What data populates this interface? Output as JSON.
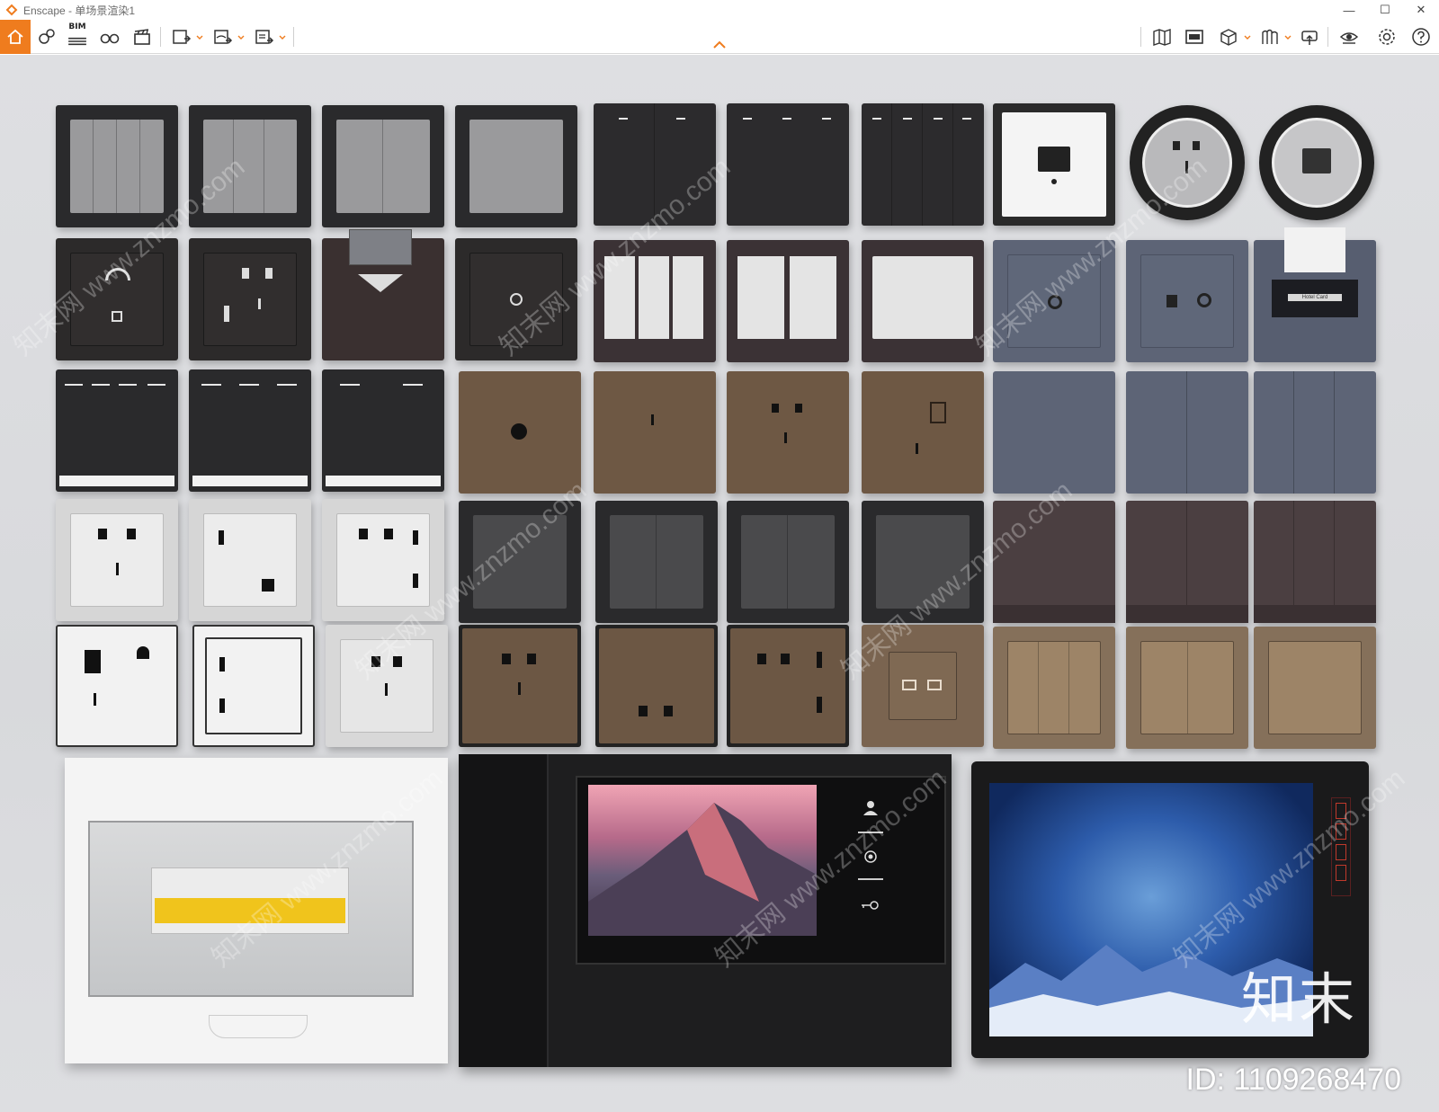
{
  "window": {
    "app_name": "Enscape",
    "separator": " - ",
    "view_name": "单场景渲染1",
    "minimize": "—",
    "maximize": "☐",
    "close": "✕"
  },
  "toolbar": {
    "left_icons": [
      "home-icon",
      "assets-icon",
      "bim-icon",
      "binoculars-icon",
      "clapper-icon",
      "export-image-icon",
      "export-360-icon",
      "export-exe-icon"
    ],
    "bim_label": "BIM",
    "right_icons": [
      "map-icon",
      "screen-icon",
      "box-icon",
      "library-icon",
      "upload-icon",
      "eye-icon",
      "settings-icon",
      "help-icon"
    ],
    "accent_color": "#ef7c1e"
  },
  "viewport": {
    "watermark_text": "知末网 www.znzmo.com",
    "brand": "知末",
    "id_label": "ID: 1109268470",
    "card_label": "Hotel Card"
  }
}
